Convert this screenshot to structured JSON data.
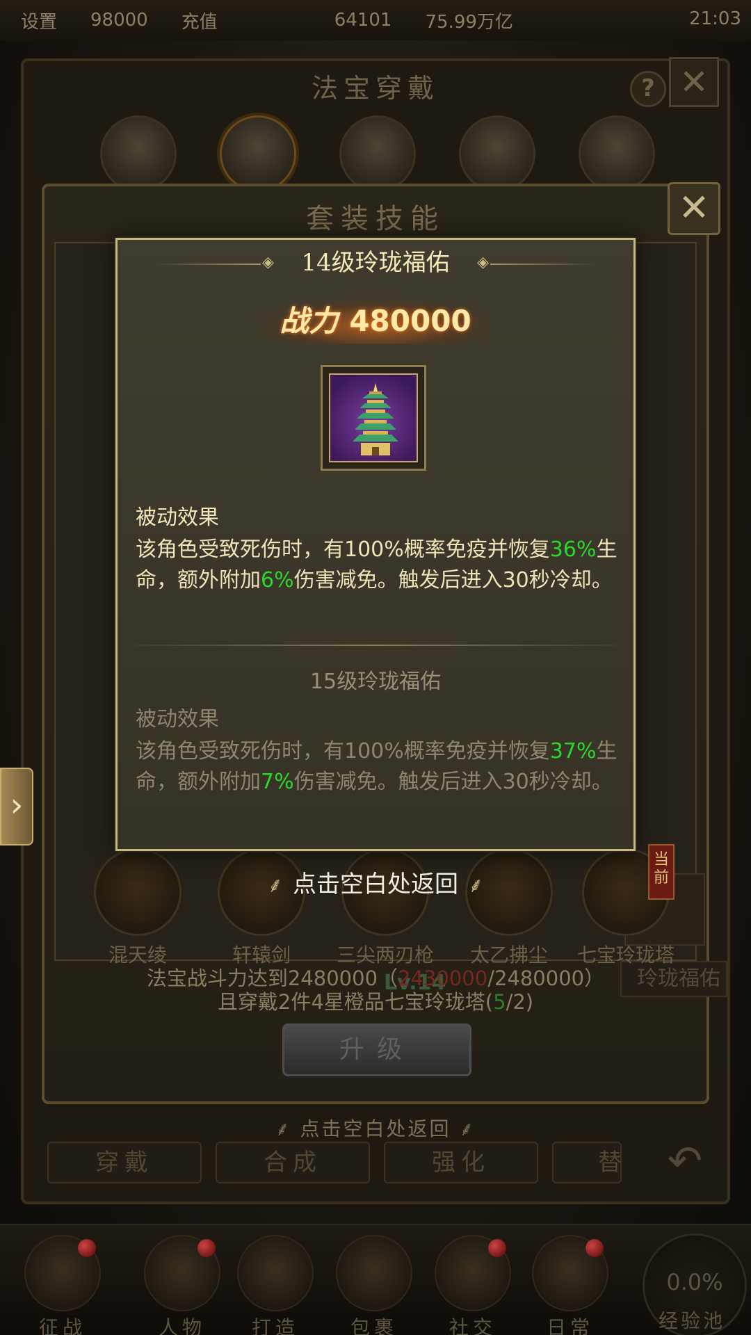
{
  "statusbar": {
    "item1": "设置",
    "value1": "98000",
    "recharge": "充值",
    "value2": "64101",
    "value3": "75.99万亿",
    "time": "21:03"
  },
  "main_panel": {
    "title": "法宝穿戴",
    "help": "?",
    "close": "✕",
    "tabs": [
      "穿戴",
      "合成",
      "强化",
      "替"
    ],
    "hint": "点击空白处返回"
  },
  "set_panel": {
    "title": "套装技能",
    "close": "✕",
    "items": [
      {
        "name": "混天绫"
      },
      {
        "name": "轩辕剑"
      },
      {
        "name": "三尖两刃枪"
      },
      {
        "name": "太乙拂尘"
      },
      {
        "name": "七宝玲珑塔"
      }
    ],
    "current_badge": "当前",
    "bg_level": "Lv.14",
    "bg_thumb_label": "玲珑福佑",
    "requirement_line1_prefix": "法宝战斗力达到2480000（",
    "requirement_current": "2430000",
    "requirement_line1_suffix": "/2480000）",
    "requirement_line2_prefix": "且穿戴2件4星橙品七宝玲珑塔(",
    "requirement_count": "5",
    "requirement_line2_suffix": "/2)",
    "upgrade_button": "升级"
  },
  "tooltip": {
    "title": "14级玲珑福佑",
    "power_label": "战力",
    "power_value": "480000",
    "icon_name": "pagoda-icon",
    "current": {
      "caption": "被动效果",
      "text_a": "该角色受致死伤时，有100%概率免疫并恢复",
      "heal": "36%",
      "text_b": "生命，额外附加",
      "reduction": "6%",
      "text_c": "伤害减免。触发后进入30秒冷却。"
    },
    "next_title": "15级玲珑福佑",
    "next": {
      "caption": "被动效果",
      "text_a": "该角色受致死伤时，有100%概率免疫并恢复",
      "heal": "37%",
      "text_b": "生命，额外附加",
      "reduction": "7%",
      "text_c": "伤害减免。触发后进入30秒冷却。"
    },
    "return_hint": "点击空白处返回"
  },
  "footer": {
    "items": [
      {
        "label": "征战"
      },
      {
        "label": "人物"
      },
      {
        "label": "打造"
      },
      {
        "label": "包裹"
      },
      {
        "label": "社交"
      },
      {
        "label": "日常"
      }
    ],
    "exp_value": "0.0%",
    "exp_label": "经验池"
  },
  "colors": {
    "highlight_green": "#2bd72b",
    "gold_text": "#f6eab8",
    "tooltip_border": "#c9b783"
  }
}
